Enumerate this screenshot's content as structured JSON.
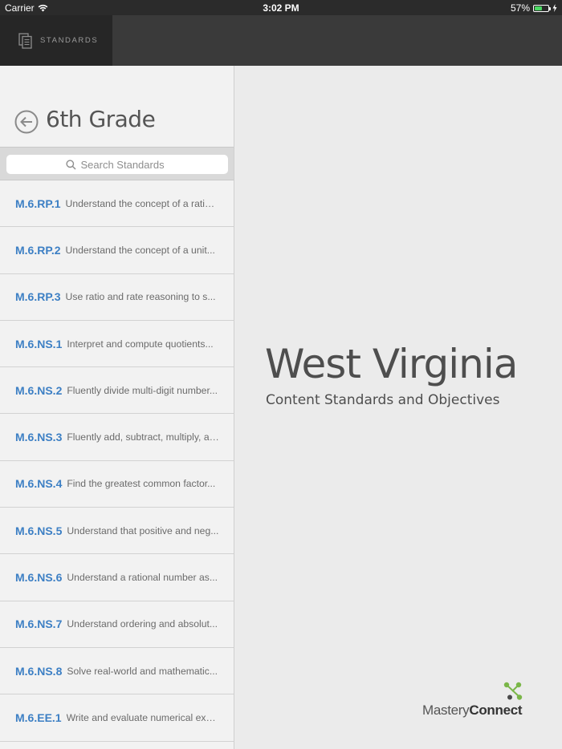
{
  "status_bar": {
    "carrier": "Carrier",
    "time": "3:02 PM",
    "battery_text": "57%",
    "battery_level": 0.57,
    "battery_color": "#4cd964"
  },
  "nav": {
    "tab_label": "STANDARDS",
    "tab_icon": "documents-icon"
  },
  "panel": {
    "title": "6th Grade",
    "back_icon": "back-arrow-icon",
    "search_placeholder": "Search Standards",
    "search_value": ""
  },
  "standards": [
    {
      "code": "M.6.RP.1",
      "desc": "Understand the concept of a ratio..."
    },
    {
      "code": "M.6.RP.2",
      "desc": "Understand the concept of a unit..."
    },
    {
      "code": "M.6.RP.3",
      "desc": "Use ratio and rate reasoning to s..."
    },
    {
      "code": "M.6.NS.1",
      "desc": "Interpret and compute quotients..."
    },
    {
      "code": "M.6.NS.2",
      "desc": "Fluently divide multi-digit number..."
    },
    {
      "code": "M.6.NS.3",
      "desc": "Fluently add, subtract, multiply, an..."
    },
    {
      "code": "M.6.NS.4",
      "desc": "Find the greatest common factor..."
    },
    {
      "code": "M.6.NS.5",
      "desc": "Understand that positive and neg..."
    },
    {
      "code": "M.6.NS.6",
      "desc": "Understand a rational number as..."
    },
    {
      "code": "M.6.NS.7",
      "desc": "Understand ordering and absolut..."
    },
    {
      "code": "M.6.NS.8",
      "desc": "Solve real-world and mathematic..."
    },
    {
      "code": "M.6.EE.1",
      "desc": "Write and evaluate numerical exp..."
    }
  ],
  "detail": {
    "state": "West Virginia",
    "subtitle": "Content Standards and Objectives"
  },
  "brand": {
    "word1": "Mastery",
    "word2": "Connect",
    "mark_color": "#7ab648"
  },
  "colors": {
    "code_blue": "#3c7fc4",
    "nav_dark": "#262626"
  }
}
